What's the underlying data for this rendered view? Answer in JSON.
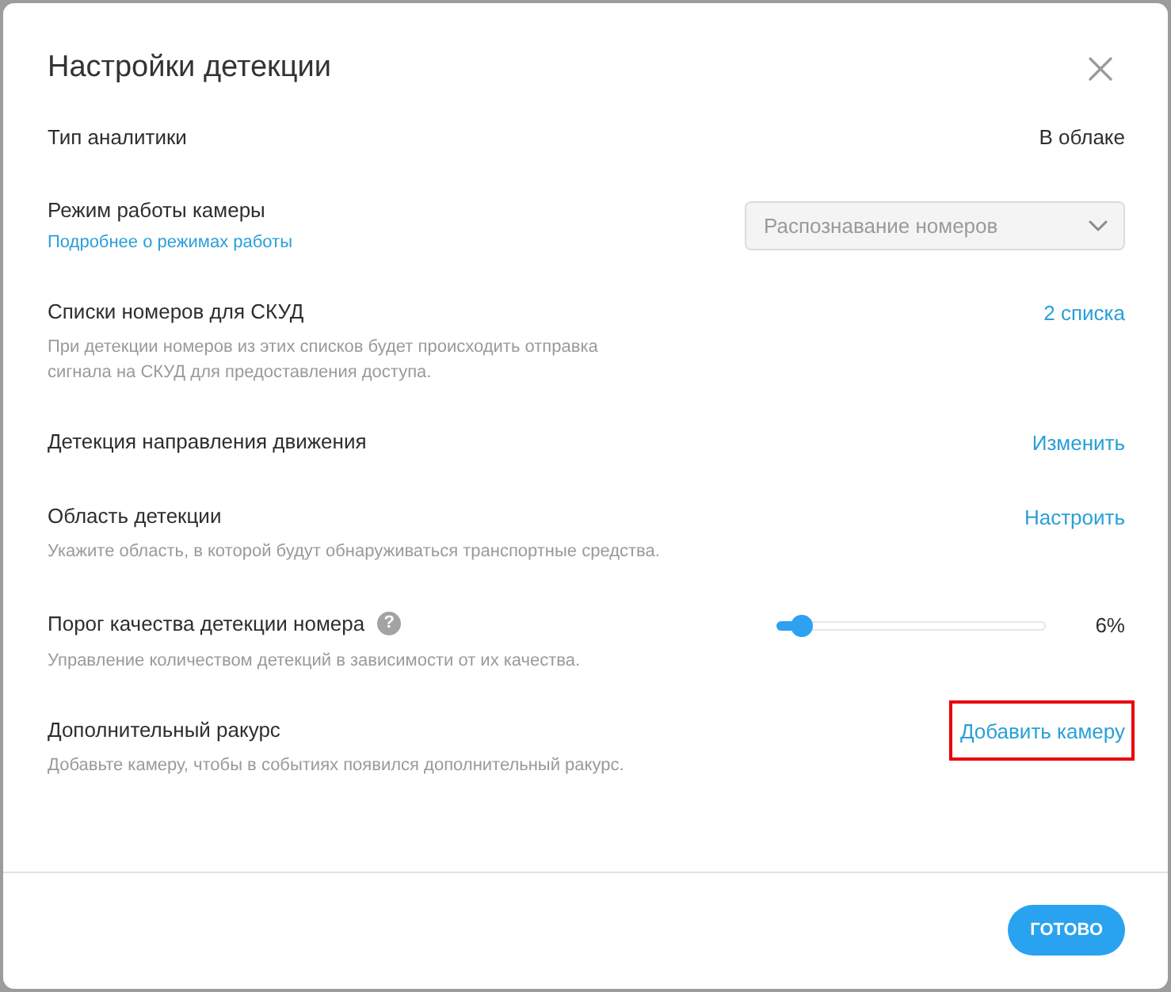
{
  "dialog": {
    "title": "Настройки детекции"
  },
  "settings": [
    {
      "kind": "value",
      "label": "Тип аналитики",
      "value": "В облаке"
    },
    {
      "kind": "select",
      "label": "Режим работы камеры",
      "link": "Подробнее о режимах работы",
      "select": {
        "value": "Распознавание номеров",
        "disabled": true
      }
    },
    {
      "kind": "action",
      "label": "Списки номеров для СКУД",
      "description": "При детекции номеров из этих списков будет происходить отправка сигнала на СКУД для предоставления доступа.",
      "action": "2 списка",
      "highlighted": false
    },
    {
      "kind": "action",
      "label": "Детекция направления движения",
      "action": "Изменить",
      "highlighted": false
    },
    {
      "kind": "action",
      "label": "Область детекции",
      "description": "Укажите область, в которой будут обнаруживаться транспортные средства.",
      "action": "Настроить",
      "highlighted": false
    },
    {
      "kind": "slider",
      "label": "Порог качества детекции номера",
      "help_icon": "?",
      "description": "Управление количеством детекций в зависимости от их качества.",
      "level": 0.06,
      "reading": "6%"
    },
    {
      "kind": "action",
      "label": "Дополнительный ракурс",
      "description": "Добавьте камеру, чтобы в событиях появился дополнительный ракурс.",
      "action": "Добавить камеру",
      "highlighted": true
    }
  ],
  "footer": {
    "button": "ГОТОВО"
  }
}
